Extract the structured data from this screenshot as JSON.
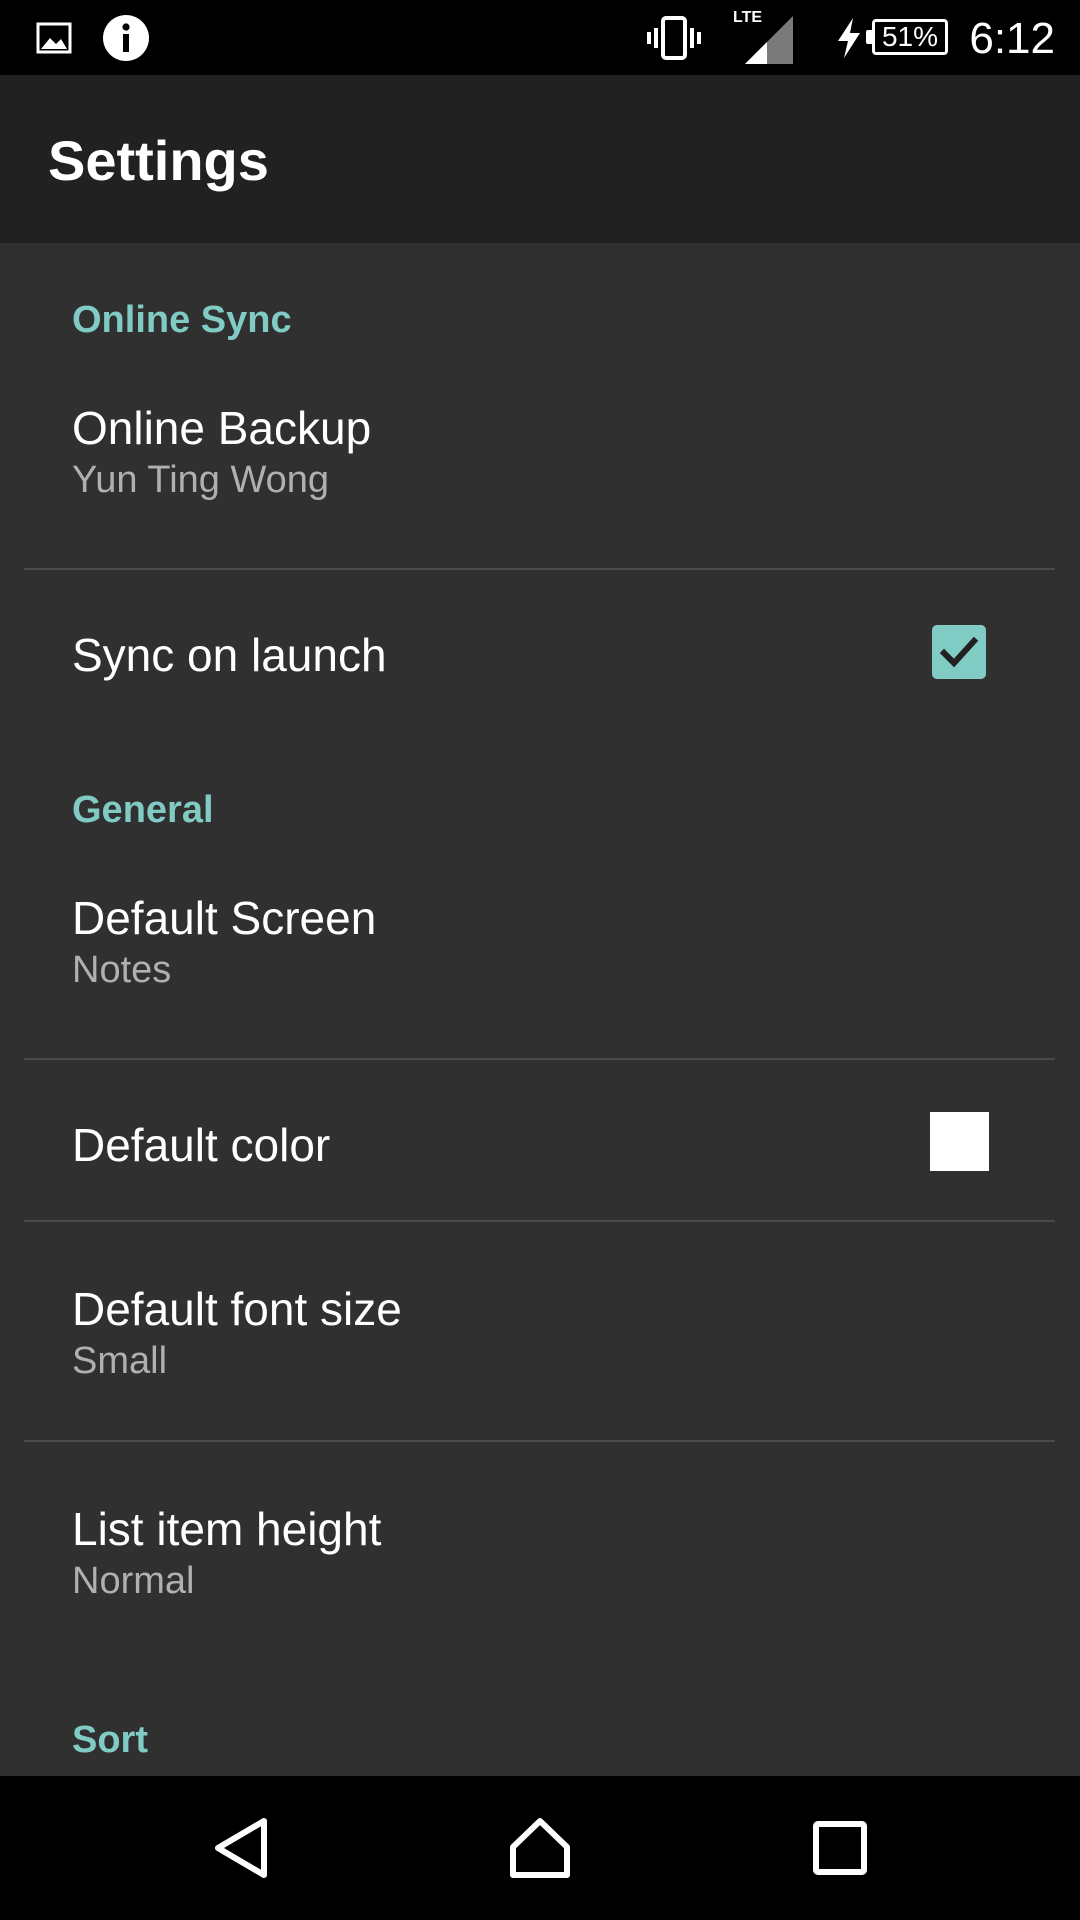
{
  "status_bar": {
    "time": "6:12",
    "battery": "51%",
    "network": "LTE",
    "icons": [
      "image-icon",
      "info-icon",
      "vibrate-icon",
      "signal-icon",
      "charging-icon",
      "battery-icon"
    ]
  },
  "toolbar": {
    "title": "Settings"
  },
  "sections": {
    "online_sync": "Online Sync",
    "general": "General",
    "sort": "Sort"
  },
  "prefs": {
    "online_backup": {
      "title": "Online Backup",
      "summary": "Yun Ting Wong"
    },
    "sync_on_launch": {
      "title": "Sync on launch",
      "checked": true
    },
    "default_screen": {
      "title": "Default Screen",
      "summary": "Notes"
    },
    "default_color": {
      "title": "Default color",
      "color": "#ffffff"
    },
    "default_font_size": {
      "title": "Default font size",
      "summary": "Small"
    },
    "list_item_height": {
      "title": "List item height",
      "summary": "Normal"
    }
  },
  "nav_bar": {
    "icons": [
      "back-icon",
      "home-icon",
      "recents-icon"
    ]
  },
  "colors": {
    "accent": "#80cbc4",
    "background": "#303030",
    "toolbar": "#212121",
    "checkbox_fill": "#80cbc4"
  }
}
